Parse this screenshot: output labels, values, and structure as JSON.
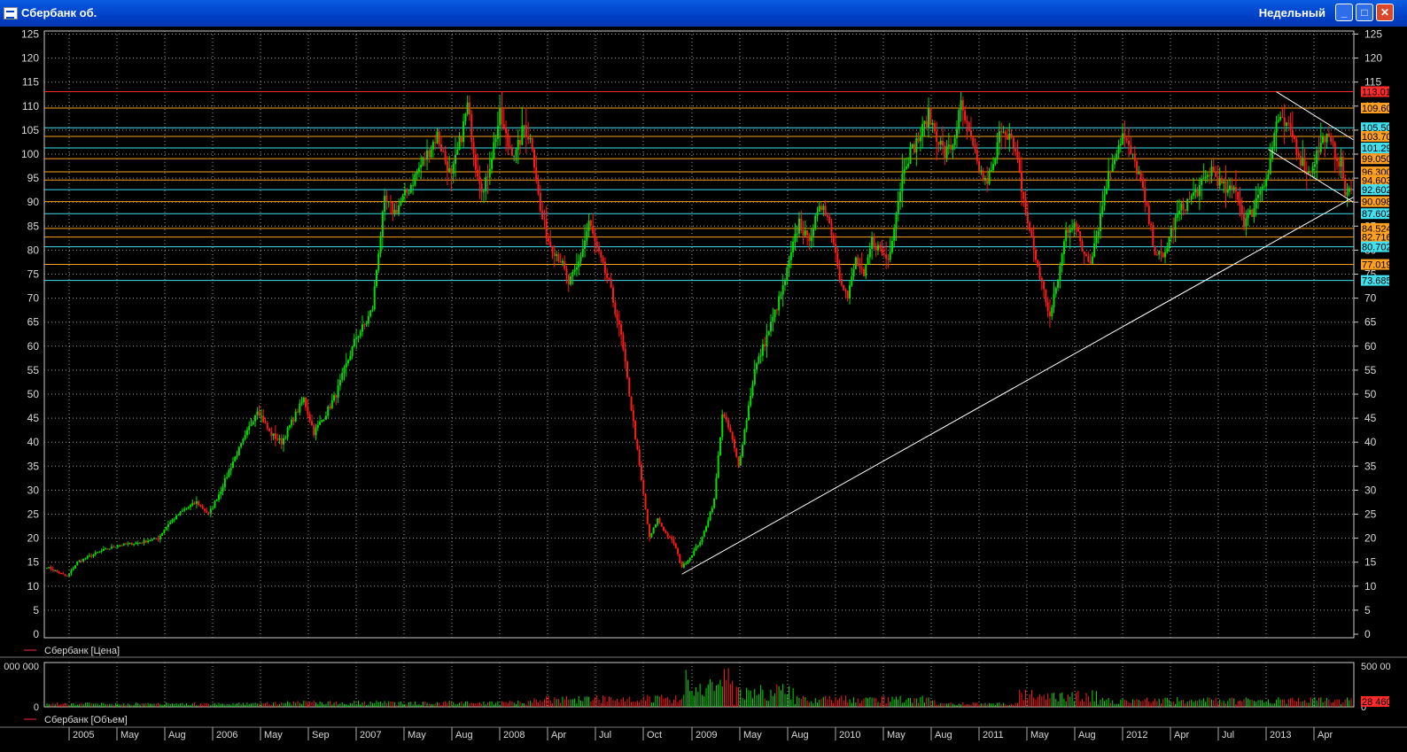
{
  "window": {
    "title": "Сбербанк об.",
    "interval": "Недельный",
    "min_icon": "minimize-icon",
    "max_icon": "maximize-icon",
    "close_icon": "close-icon"
  },
  "chart_data": {
    "type": "candlestick",
    "legend": {
      "price": "Сбербанк [Цена]",
      "volume": "Сбербанк [Объем]"
    },
    "price_axis": {
      "ylim": [
        0,
        125
      ],
      "ticks": [
        0,
        5,
        10,
        15,
        20,
        25,
        30,
        35,
        40,
        45,
        50,
        55,
        60,
        65,
        70,
        75,
        80,
        85,
        90,
        95,
        100,
        105,
        110,
        115,
        120,
        125
      ]
    },
    "volume_axis": {
      "ticks_right": [
        "500 00",
        "0"
      ],
      "ticks_left": [
        "000 000",
        "0"
      ],
      "last_volume_label": "28 460"
    },
    "x_labels": [
      "2005",
      "May",
      "Aug",
      "2006",
      "May",
      "Sep",
      "2007",
      "May",
      "Aug",
      "2008",
      "Apr",
      "Jul",
      "Oct",
      "2009",
      "May",
      "Aug",
      "2010",
      "May",
      "Aug",
      "2011",
      "May",
      "Aug",
      "2012",
      "Apr",
      "Jul",
      "2013",
      "Apr"
    ],
    "price_keypoints": [
      [
        0,
        14
      ],
      [
        5,
        13
      ],
      [
        10,
        12
      ],
      [
        15,
        15
      ],
      [
        25,
        17
      ],
      [
        35,
        18.5
      ],
      [
        45,
        19
      ],
      [
        55,
        20
      ],
      [
        60,
        23
      ],
      [
        68,
        26
      ],
      [
        74,
        27.5
      ],
      [
        80,
        25
      ],
      [
        86,
        30
      ],
      [
        92,
        36
      ],
      [
        98,
        41
      ],
      [
        104,
        47
      ],
      [
        110,
        42
      ],
      [
        116,
        40
      ],
      [
        122,
        45
      ],
      [
        127,
        49
      ],
      [
        132,
        42
      ],
      [
        138,
        46
      ],
      [
        143,
        50
      ],
      [
        148,
        56
      ],
      [
        153,
        62
      ],
      [
        158,
        65
      ],
      [
        161,
        68
      ],
      [
        164,
        80
      ],
      [
        167,
        90
      ],
      [
        172,
        88
      ],
      [
        178,
        92
      ],
      [
        184,
        97
      ],
      [
        188,
        100
      ],
      [
        193,
        104
      ],
      [
        196,
        100
      ],
      [
        200,
        95
      ],
      [
        205,
        104
      ],
      [
        208,
        110
      ],
      [
        212,
        98
      ],
      [
        216,
        92
      ],
      [
        220,
        100
      ],
      [
        224,
        108
      ],
      [
        228,
        102
      ],
      [
        232,
        100
      ],
      [
        236,
        106
      ],
      [
        240,
        102
      ],
      [
        244,
        88
      ],
      [
        248,
        82
      ],
      [
        254,
        78
      ],
      [
        258,
        73
      ],
      [
        262,
        76
      ],
      [
        266,
        82
      ],
      [
        268,
        86
      ],
      [
        272,
        80
      ],
      [
        278,
        73
      ],
      [
        284,
        62
      ],
      [
        290,
        44
      ],
      [
        294,
        32
      ],
      [
        298,
        20
      ],
      [
        302,
        24
      ],
      [
        306,
        21
      ],
      [
        310,
        19
      ],
      [
        314,
        14
      ],
      [
        318,
        16
      ],
      [
        324,
        20
      ],
      [
        330,
        28
      ],
      [
        334,
        46
      ],
      [
        338,
        42
      ],
      [
        342,
        35
      ],
      [
        346,
        45
      ],
      [
        350,
        55
      ],
      [
        356,
        62
      ],
      [
        360,
        67
      ],
      [
        364,
        72
      ],
      [
        368,
        79
      ],
      [
        372,
        86
      ],
      [
        376,
        82
      ],
      [
        380,
        86
      ],
      [
        384,
        90
      ],
      [
        388,
        84
      ],
      [
        392,
        75
      ],
      [
        396,
        70
      ],
      [
        400,
        78
      ],
      [
        404,
        74
      ],
      [
        408,
        82
      ],
      [
        412,
        80
      ],
      [
        416,
        78
      ],
      [
        420,
        88
      ],
      [
        424,
        98
      ],
      [
        428,
        101
      ],
      [
        432,
        104
      ],
      [
        436,
        108
      ],
      [
        440,
        104
      ],
      [
        444,
        100
      ],
      [
        448,
        102
      ],
      [
        452,
        110
      ],
      [
        456,
        104
      ],
      [
        460,
        98
      ],
      [
        464,
        94
      ],
      [
        468,
        97
      ],
      [
        472,
        106
      ],
      [
        476,
        104
      ],
      [
        480,
        98
      ],
      [
        484,
        88
      ],
      [
        488,
        80
      ],
      [
        492,
        73
      ],
      [
        496,
        66
      ],
      [
        500,
        74
      ],
      [
        504,
        84
      ],
      [
        508,
        86
      ],
      [
        512,
        80
      ],
      [
        516,
        78
      ],
      [
        520,
        85
      ],
      [
        524,
        94
      ],
      [
        528,
        100
      ],
      [
        532,
        104
      ],
      [
        536,
        100
      ],
      [
        540,
        96
      ],
      [
        544,
        88
      ],
      [
        548,
        80
      ],
      [
        552,
        78
      ],
      [
        556,
        84
      ],
      [
        560,
        88
      ],
      [
        564,
        90
      ],
      [
        568,
        92
      ],
      [
        572,
        94
      ],
      [
        576,
        97
      ],
      [
        580,
        94
      ],
      [
        584,
        92
      ],
      [
        588,
        93
      ],
      [
        592,
        86
      ],
      [
        596,
        88
      ],
      [
        600,
        93
      ],
      [
        604,
        96
      ],
      [
        608,
        107
      ],
      [
        612,
        106
      ],
      [
        616,
        104
      ],
      [
        620,
        99
      ],
      [
        624,
        96
      ],
      [
        628,
        100
      ],
      [
        632,
        104
      ],
      [
        636,
        101
      ],
      [
        640,
        98
      ],
      [
        642,
        92
      ]
    ],
    "horizontal_levels": [
      {
        "value": 113.01,
        "color": "#ff2a2a",
        "label": "113.01"
      },
      {
        "value": 109.6,
        "color": "#ffa020",
        "label": "109.60"
      },
      {
        "value": 105.5,
        "color": "#40e0f0",
        "label": "105.50"
      },
      {
        "value": 103.7,
        "color": "#ffa020",
        "label": "103.70"
      },
      {
        "value": 101.29,
        "color": "#40e0f0",
        "label": "101.29"
      },
      {
        "value": 99.05,
        "color": "#ffa020",
        "label": "99.050"
      },
      {
        "value": 96.3,
        "color": "#ffa020",
        "label": "96.300"
      },
      {
        "value": 94.603,
        "color": "#ffa020",
        "label": "94.603"
      },
      {
        "value": 92.602,
        "color": "#40e0f0",
        "label": "92.602"
      },
      {
        "value": 90.098,
        "color": "#ffa020",
        "label": "90.098"
      },
      {
        "value": 87.602,
        "color": "#40e0f0",
        "label": "87.602"
      },
      {
        "value": 84.524,
        "color": "#ffa020",
        "label": "84.524"
      },
      {
        "value": 82.716,
        "color": "#ffa020",
        "label": "82.716"
      },
      {
        "value": 80.702,
        "color": "#40e0f0",
        "label": "80.702"
      },
      {
        "value": 77.019,
        "color": "#ffa020",
        "label": "77.019"
      },
      {
        "value": 73.685,
        "color": "#40e0f0",
        "label": "73.685"
      }
    ],
    "trendlines": [
      {
        "from": [
          314,
          12.5
        ],
        "to": [
          646,
          91
        ]
      },
      {
        "from": [
          608,
          113
        ],
        "to": [
          646,
          103
        ]
      },
      {
        "from": [
          604,
          101
        ],
        "to": [
          646,
          90
        ]
      }
    ],
    "colors": {
      "up": "#00e000",
      "down": "#ff1a1a",
      "grid": "#9a9a9a",
      "text": "#d8d8d8"
    }
  }
}
